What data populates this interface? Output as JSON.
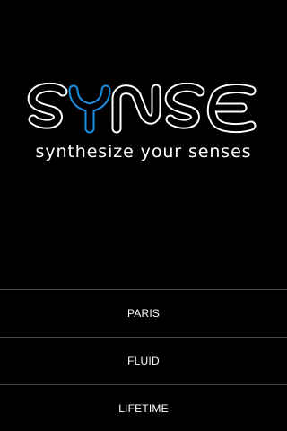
{
  "brand": {
    "logo_text": "SYNSE",
    "tagline": "synthesize your senses",
    "accent_color": "#1a8fe3"
  },
  "menu": {
    "items": [
      {
        "label": "PARIS"
      },
      {
        "label": "FLUID"
      },
      {
        "label": "LIFETIME"
      }
    ]
  }
}
